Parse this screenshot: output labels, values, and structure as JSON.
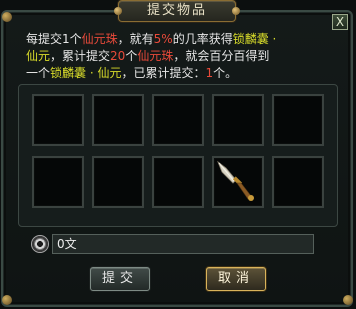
{
  "window": {
    "title": "提交物品",
    "close_label": "X"
  },
  "description": {
    "line1_a": "每提交1个",
    "line1_b": "仙元珠",
    "line1_c": "，就有",
    "line1_d": "5%",
    "line1_e": "的几率获得",
    "line1_f": "锁麟囊 ·",
    "line2_a": "仙元",
    "line2_b": "，累计提交",
    "line2_c": "20",
    "line2_d": "个",
    "line2_e": "仙元珠",
    "line2_f": "，就会百分百得到",
    "line3_a": "一个",
    "line3_b": "锁麟囊 · 仙元",
    "line3_c": "，已累计提交：",
    "line3_d": "1",
    "line3_e": "个。"
  },
  "slots": [
    {
      "item": ""
    },
    {
      "item": ""
    },
    {
      "item": ""
    },
    {
      "item": ""
    },
    {
      "item": ""
    },
    {
      "item": ""
    },
    {
      "item": ""
    },
    {
      "item": ""
    },
    {
      "item": "dagger-item"
    },
    {
      "item": ""
    }
  ],
  "money": {
    "value": "0文",
    "icon": "coin-icon"
  },
  "buttons": {
    "submit": "提交",
    "cancel": "取消"
  },
  "colors": {
    "highlight_red": "#e84a3a",
    "highlight_yellow": "#d8dc2a",
    "gold_border": "#d9b35b"
  }
}
